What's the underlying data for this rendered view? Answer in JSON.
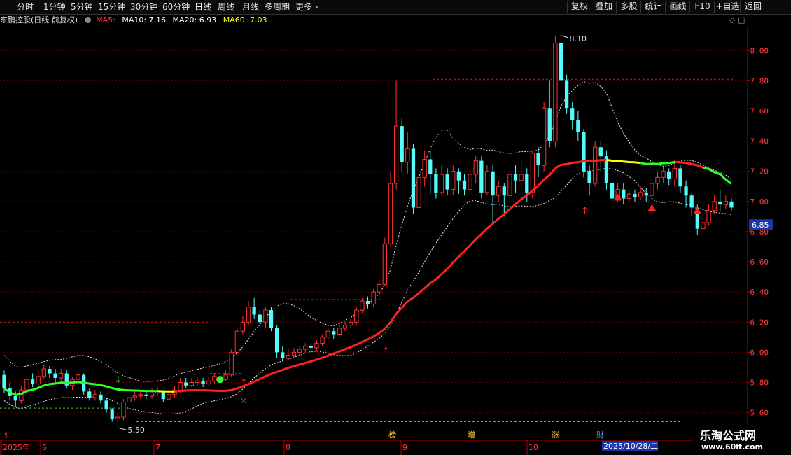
{
  "toolbar": {
    "periods": [
      "分时",
      "1分钟",
      "5分钟",
      "15分钟",
      "30分钟",
      "60分钟",
      "日线",
      "周线",
      "月线",
      "多周期",
      "更多"
    ],
    "active_period": "日线",
    "buttons": [
      "复权",
      "叠加",
      "多股",
      "统计",
      "画线",
      "F10",
      "+自选",
      "返回"
    ],
    "corner_icons": "◇ □"
  },
  "infobar": {
    "title": "东鹏控股(日线 前复权)",
    "ma5_label": "MA5:",
    "ma10": "MA10: 7.16",
    "ma20": "MA20: 6.93",
    "ma60": "MA60: 7.03"
  },
  "colors": {
    "up": "#ff3232",
    "down": "#54fcfc",
    "ma5": "#ffffff",
    "ma60_red": "#ff2020",
    "ma60_yellow": "#ffff00",
    "ma60_green": "#2bff2b",
    "axis": "#b40000",
    "current": "#1a35a8"
  },
  "chart_data": {
    "type": "candlestick",
    "ylim": [
      5.5,
      8.15
    ],
    "yticks": [
      "8.00",
      "7.80",
      "7.60",
      "7.40",
      "7.20",
      "7.00",
      "6.80",
      "6.60",
      "6.40",
      "6.20",
      "6.00",
      "5.80",
      "5.60"
    ],
    "current_price": "6.85",
    "high_label": "8.10",
    "low_label": "5.50",
    "months": [
      "2025年",
      "6",
      "7",
      "8",
      "9",
      "10"
    ],
    "markers": [
      "榜",
      "增",
      "涨",
      "财"
    ],
    "cursor_date": "2025/10/28/二",
    "candles": [
      [
        5.85,
        5.76,
        5.88,
        5.73
      ],
      [
        5.76,
        5.71,
        5.8,
        5.68
      ],
      [
        5.71,
        5.68,
        5.74,
        5.64
      ],
      [
        5.68,
        5.75,
        5.78,
        5.66
      ],
      [
        5.75,
        5.82,
        5.85,
        5.73
      ],
      [
        5.82,
        5.79,
        5.86,
        5.77
      ],
      [
        5.79,
        5.84,
        5.88,
        5.77
      ],
      [
        5.84,
        5.89,
        5.92,
        5.82
      ],
      [
        5.89,
        5.86,
        5.91,
        5.83
      ],
      [
        5.86,
        5.83,
        5.89,
        5.8
      ],
      [
        5.83,
        5.86,
        5.89,
        5.81
      ],
      [
        5.86,
        5.78,
        5.88,
        5.76
      ],
      [
        5.78,
        5.82,
        5.84,
        5.75
      ],
      [
        5.82,
        5.85,
        5.87,
        5.79
      ],
      [
        5.85,
        5.74,
        5.86,
        5.72
      ],
      [
        5.74,
        5.7,
        5.76,
        5.68
      ],
      [
        5.7,
        5.72,
        5.75,
        5.68
      ],
      [
        5.72,
        5.68,
        5.74,
        5.66
      ],
      [
        5.68,
        5.62,
        5.7,
        5.6
      ],
      [
        5.62,
        5.56,
        5.63,
        5.54
      ],
      [
        5.56,
        5.57,
        5.6,
        5.5
      ],
      [
        5.57,
        5.67,
        5.69,
        5.55
      ],
      [
        5.67,
        5.7,
        5.73,
        5.64
      ],
      [
        5.7,
        5.71,
        5.74,
        5.68
      ],
      [
        5.71,
        5.72,
        5.75,
        5.69
      ],
      [
        5.72,
        5.71,
        5.74,
        5.69
      ],
      [
        5.71,
        5.73,
        5.76,
        5.69
      ],
      [
        5.73,
        5.74,
        5.77,
        5.71
      ],
      [
        5.74,
        5.69,
        5.75,
        5.67
      ],
      [
        5.69,
        5.72,
        5.74,
        5.67
      ],
      [
        5.72,
        5.75,
        5.78,
        5.7
      ],
      [
        5.75,
        5.8,
        5.83,
        5.73
      ],
      [
        5.8,
        5.78,
        5.83,
        5.76
      ],
      [
        5.78,
        5.8,
        5.83,
        5.77
      ],
      [
        5.8,
        5.81,
        5.84,
        5.78
      ],
      [
        5.81,
        5.79,
        5.83,
        5.77
      ],
      [
        5.79,
        5.81,
        5.84,
        5.78
      ],
      [
        5.81,
        5.84,
        5.86,
        5.79
      ],
      [
        5.84,
        5.82,
        5.86,
        5.8
      ],
      [
        5.82,
        5.85,
        5.88,
        5.81
      ],
      [
        5.85,
        6.0,
        6.02,
        5.84
      ],
      [
        6.0,
        6.14,
        6.16,
        5.98
      ],
      [
        6.14,
        6.2,
        6.24,
        6.12
      ],
      [
        6.2,
        6.3,
        6.34,
        6.18
      ],
      [
        6.3,
        6.25,
        6.36,
        6.22
      ],
      [
        6.25,
        6.2,
        6.28,
        6.18
      ],
      [
        6.2,
        6.28,
        6.3,
        6.16
      ],
      [
        6.28,
        6.16,
        6.3,
        6.14
      ],
      [
        6.16,
        6.0,
        6.18,
        5.96
      ],
      [
        6.0,
        5.96,
        6.04,
        5.94
      ],
      [
        5.96,
        5.98,
        6.02,
        5.95
      ],
      [
        5.98,
        6.0,
        6.03,
        5.96
      ],
      [
        6.0,
        6.02,
        6.04,
        5.98
      ],
      [
        6.02,
        6.04,
        6.06,
        6.0
      ],
      [
        6.04,
        6.03,
        6.06,
        6.0
      ],
      [
        6.03,
        6.06,
        6.08,
        6.01
      ],
      [
        6.06,
        6.1,
        6.12,
        6.04
      ],
      [
        6.1,
        6.14,
        6.16,
        6.08
      ],
      [
        6.14,
        6.12,
        6.16,
        6.09
      ],
      [
        6.12,
        6.16,
        6.19,
        6.1
      ],
      [
        6.16,
        6.18,
        6.21,
        6.14
      ],
      [
        6.18,
        6.2,
        6.23,
        6.16
      ],
      [
        6.2,
        6.28,
        6.3,
        6.18
      ],
      [
        6.28,
        6.34,
        6.36,
        6.26
      ],
      [
        6.34,
        6.32,
        6.37,
        6.29
      ],
      [
        6.32,
        6.4,
        6.42,
        6.3
      ],
      [
        6.4,
        6.45,
        6.48,
        6.36
      ],
      [
        6.45,
        6.72,
        6.76,
        6.44
      ],
      [
        6.72,
        7.12,
        7.2,
        6.7
      ],
      [
        7.12,
        7.5,
        7.8,
        7.08
      ],
      [
        7.5,
        7.26,
        7.55,
        7.2
      ],
      [
        7.26,
        7.35,
        7.46,
        7.18
      ],
      [
        7.35,
        6.96,
        7.38,
        6.92
      ],
      [
        6.96,
        7.16,
        7.2,
        6.94
      ],
      [
        7.16,
        7.28,
        7.34,
        7.1
      ],
      [
        7.28,
        7.18,
        7.34,
        7.05
      ],
      [
        7.18,
        7.06,
        7.22,
        7.02
      ],
      [
        7.06,
        7.18,
        7.24,
        7.04
      ],
      [
        7.18,
        7.08,
        7.22,
        7.04
      ],
      [
        7.08,
        7.2,
        7.24,
        7.04
      ],
      [
        7.2,
        7.14,
        7.22,
        7.05
      ],
      [
        7.14,
        7.08,
        7.18,
        7.04
      ],
      [
        7.08,
        7.18,
        7.24,
        7.05
      ],
      [
        7.18,
        7.27,
        7.3,
        7.12
      ],
      [
        7.27,
        7.06,
        7.3,
        7.02
      ],
      [
        7.06,
        7.2,
        7.24,
        7.04
      ],
      [
        7.2,
        7.04,
        7.24,
        6.86
      ],
      [
        7.04,
        7.1,
        7.14,
        7.0
      ],
      [
        7.1,
        7.04,
        7.12,
        6.9
      ],
      [
        7.04,
        7.18,
        7.22,
        7.0
      ],
      [
        7.18,
        7.14,
        7.24,
        7.06
      ],
      [
        7.14,
        7.18,
        7.28,
        7.08
      ],
      [
        7.18,
        7.06,
        7.22,
        7.0
      ],
      [
        7.06,
        7.32,
        7.34,
        7.02
      ],
      [
        7.32,
        7.24,
        7.36,
        7.16
      ],
      [
        7.24,
        7.62,
        7.66,
        7.2
      ],
      [
        7.62,
        7.4,
        7.8,
        7.36
      ],
      [
        7.4,
        8.05,
        8.1,
        7.36
      ],
      [
        8.05,
        7.8,
        8.1,
        7.64
      ],
      [
        7.8,
        7.62,
        7.84,
        7.58
      ],
      [
        7.62,
        7.54,
        7.66,
        7.48
      ],
      [
        7.54,
        7.46,
        7.6,
        7.4
      ],
      [
        7.46,
        7.2,
        7.48,
        7.16
      ],
      [
        7.2,
        7.12,
        7.24,
        7.04
      ],
      [
        7.12,
        7.36,
        7.4,
        7.1
      ],
      [
        7.36,
        7.3,
        7.4,
        7.2
      ],
      [
        7.3,
        7.12,
        7.34,
        7.08
      ],
      [
        7.12,
        7.02,
        7.16,
        6.98
      ],
      [
        7.02,
        7.08,
        7.12,
        7.0
      ],
      [
        7.08,
        7.02,
        7.12,
        6.98
      ],
      [
        7.02,
        7.05,
        7.08,
        7.0
      ],
      [
        7.05,
        7.03,
        7.08,
        7.0
      ],
      [
        7.03,
        7.06,
        7.1,
        7.01
      ],
      [
        7.06,
        7.04,
        7.09,
        7.0
      ],
      [
        7.04,
        7.12,
        7.16,
        7.02
      ],
      [
        7.12,
        7.16,
        7.2,
        7.08
      ],
      [
        7.16,
        7.2,
        7.23,
        7.12
      ],
      [
        7.2,
        7.15,
        7.22,
        7.11
      ],
      [
        7.15,
        7.22,
        7.28,
        7.1
      ],
      [
        7.22,
        7.1,
        7.24,
        7.06
      ],
      [
        7.1,
        7.04,
        7.14,
        6.96
      ],
      [
        7.04,
        6.96,
        7.06,
        6.9
      ],
      [
        6.96,
        6.82,
        6.98,
        6.78
      ],
      [
        6.82,
        6.86,
        6.9,
        6.8
      ],
      [
        6.86,
        6.94,
        6.98,
        6.84
      ],
      [
        6.94,
        7.0,
        7.04,
        6.92
      ],
      [
        7.0,
        6.98,
        7.08,
        6.94
      ],
      [
        6.98,
        7.0,
        7.04,
        6.95
      ],
      [
        7.0,
        6.96,
        7.02,
        6.94
      ]
    ]
  }
}
